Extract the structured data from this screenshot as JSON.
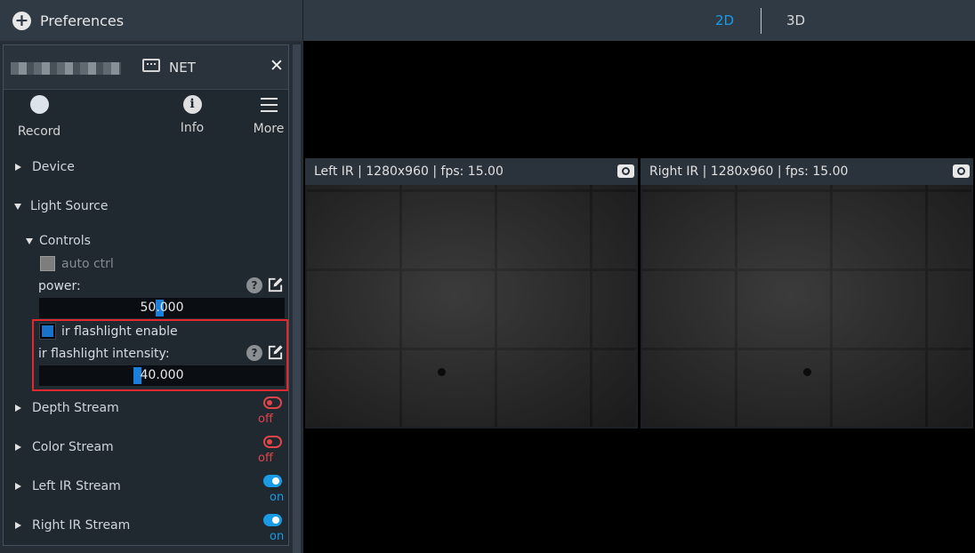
{
  "topbar": {
    "preferences_label": "Preferences",
    "tabs": [
      {
        "label": "2D",
        "active": true
      },
      {
        "label": "3D",
        "active": false
      }
    ]
  },
  "panel": {
    "device_type": "NET",
    "tools": [
      {
        "label": "Record",
        "icon": "record-icon"
      },
      {
        "label": "Info",
        "icon": "info-icon"
      },
      {
        "label": "More",
        "icon": "hamburger-menu-icon"
      }
    ],
    "sections": {
      "device": "Device",
      "light_source": "Light Source",
      "controls": "Controls"
    },
    "controls": {
      "auto_ctrl_label": "auto ctrl",
      "power_label": "power:",
      "power_value": "50.000",
      "ir_enable_label": "ir flashlight enable",
      "ir_intensity_label": "ir flashlight intensity:",
      "ir_intensity_value": "40.000"
    },
    "streams": [
      {
        "label": "Depth Stream",
        "state": "off"
      },
      {
        "label": "Color Stream",
        "state": "off"
      },
      {
        "label": "Left IR Stream",
        "state": "on"
      },
      {
        "label": "Right IR Stream",
        "state": "on"
      }
    ]
  },
  "viewer": {
    "left_ir_title": "Left IR | 1280x960 | fps: 15.00",
    "right_ir_title": "Right IR | 1280x960 | fps: 15.00"
  },
  "colors": {
    "accent": "#1a9be6",
    "off": "#e0454a",
    "highlight": "#e0282e"
  }
}
